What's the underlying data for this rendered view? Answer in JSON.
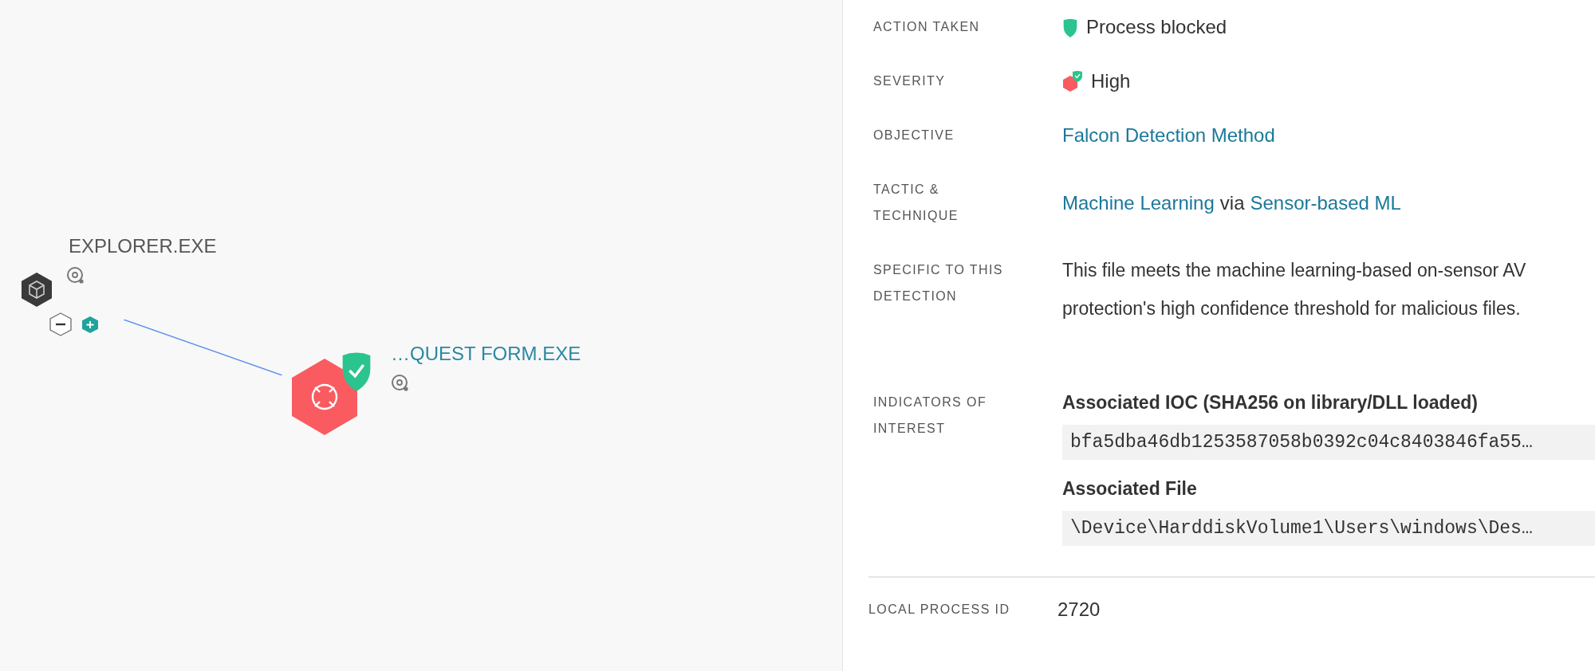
{
  "graph": {
    "nodes": [
      {
        "label": "EXPLORER.EXE",
        "kind": "parent"
      },
      {
        "label": "…QUEST FORM.EXE",
        "kind": "detection",
        "blocked": true
      }
    ]
  },
  "details": {
    "rows": [
      {
        "label": "ACTION TAKEN",
        "kind": "action",
        "value": "Process blocked"
      },
      {
        "label": "SEVERITY",
        "kind": "severity",
        "value": "High"
      },
      {
        "label": "OBJECTIVE",
        "kind": "links",
        "parts": [
          {
            "text": "Falcon Detection Method",
            "link": true
          }
        ]
      },
      {
        "label": "TACTIC & TECHNIQUE",
        "kind": "links",
        "parts": [
          {
            "text": "Machine Learning",
            "link": true
          },
          {
            "text": "via",
            "link": false
          },
          {
            "text": "Sensor-based ML",
            "link": true
          }
        ]
      },
      {
        "label": "SPECIFIC TO THIS DETECTION",
        "kind": "text",
        "value": "This file meets the machine learning-based on-sensor AV protection's high confidence threshold for malicious files."
      },
      {
        "label": "INDICATORS OF INTEREST",
        "kind": "indicators",
        "items": [
          {
            "title": "Associated IOC (SHA256 on library/DLL loaded)",
            "value": "bfa5dba46db1253587058b0392c04c8403846fa55…"
          },
          {
            "title": "Associated File",
            "value": "\\Device\\HarddiskVolume1\\Users\\windows\\Des…"
          }
        ]
      }
    ]
  },
  "process_info": {
    "rows": [
      {
        "label": "LOCAL PROCESS ID",
        "kind": "plain",
        "value": "2720"
      }
    ]
  }
}
